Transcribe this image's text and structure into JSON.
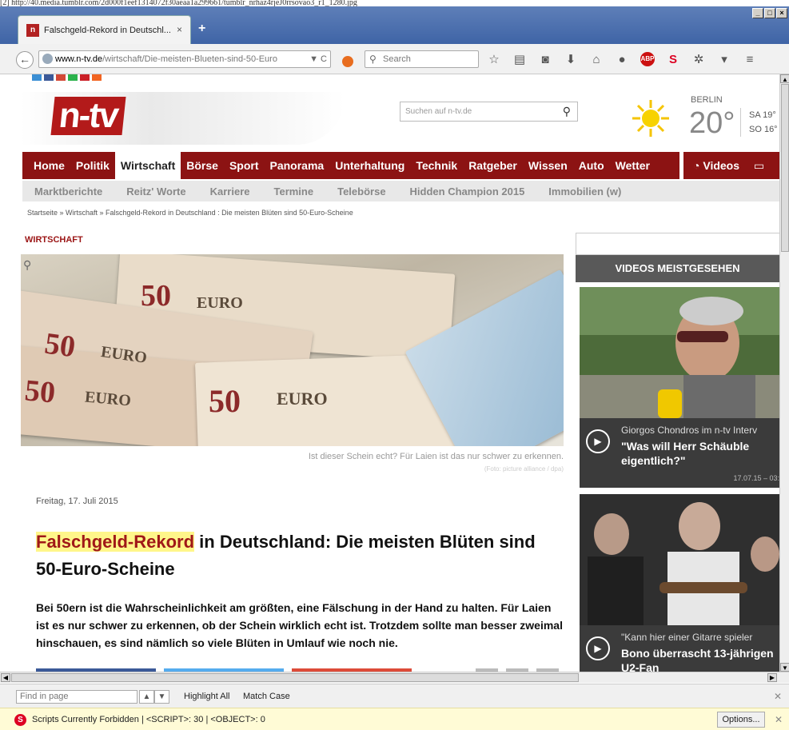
{
  "top_url": "[2] http://40.media.tumblr.com/2d000f1eef1314072f30aeaa1a299661/tumblr_nrhaz4rjeJ0rrsovao3_r1_1280.jpg",
  "window": {
    "min": "_",
    "max": "□",
    "close": "×"
  },
  "tab": {
    "title": "Falschgeld-Rekord in Deutschl...",
    "close": "×",
    "new_tab": "+"
  },
  "nav": {
    "url_domain": "www.n-tv.de",
    "url_path": "/wirtschaft/Die-meisten-Blueten-sind-50-Euro",
    "url_icons": "▼ C",
    "search_placeholder": "Search"
  },
  "site": {
    "logo": "n-tv",
    "search_placeholder": "Suchen auf n-tv.de",
    "weather": {
      "city": "BERLIN",
      "temp": "20°",
      "forecast": [
        "SA 19°",
        "SO 16°"
      ]
    },
    "main_nav": [
      "Home",
      "Politik",
      "Wirtschaft",
      "Börse",
      "Sport",
      "Panorama",
      "Unterhaltung",
      "Technik",
      "Ratgeber",
      "Wissen",
      "Auto",
      "Wetter"
    ],
    "videos_label": "Videos",
    "sub_nav": [
      "Marktberichte",
      "Reitz' Worte",
      "Karriere",
      "Termine",
      "Telebörse",
      "Hidden Champion 2015",
      "Immobilien (w)"
    ],
    "breadcrumb": "Startseite » Wirtschaft » Falschgeld-Rekord in Deutschland : Die meisten Blüten sind 50-Euro-Scheine"
  },
  "article": {
    "section": "WIRTSCHAFT",
    "caption": "Ist dieser Schein echt? Für Laien ist das nur schwer zu erkennen.",
    "credit": "(Foto: picture alliance / dpa)",
    "date": "Freitag, 17. Juli 2015",
    "headline_highlight": "Falschgeld-Rekord",
    "headline_rest": " in Deutschland: Die meisten Blüten sind 50-Euro-Scheine",
    "lead": "Bei 50ern ist die Wahrscheinlichkeit am größten, eine Fälschung in der Hand zu halten. Für Laien ist es nur schwer zu erkennen, ob der Schein wirklich echt ist. Trotzdem sollte man besser zweimal hinschauen, es sind nämlich so viele Blüten in Umlauf wie noch nie.",
    "note_labels": [
      "50",
      "EURO"
    ]
  },
  "sidebar": {
    "heading": "VIDEOS MEISTGESEHEN",
    "videos": [
      {
        "kicker": "Giorgos Chondros im n-tv Interv",
        "title1": "\"Was will Herr Schäuble",
        "title2": "eigentlich?\"",
        "timestamp": "17.07.15 – 03:"
      },
      {
        "kicker": "\"Kann hier einer Gitarre spieler",
        "title1": "Bono überrascht 13-jährigen",
        "title2": "U2-Fan"
      }
    ]
  },
  "findbar": {
    "placeholder": "Find in page",
    "highlight_all": "Highlight All",
    "match_case": "Match Case"
  },
  "statusbar": {
    "text": "Scripts Currently Forbidden | <SCRIPT>: 30 | <OBJECT>: 0",
    "options": "Options..."
  }
}
